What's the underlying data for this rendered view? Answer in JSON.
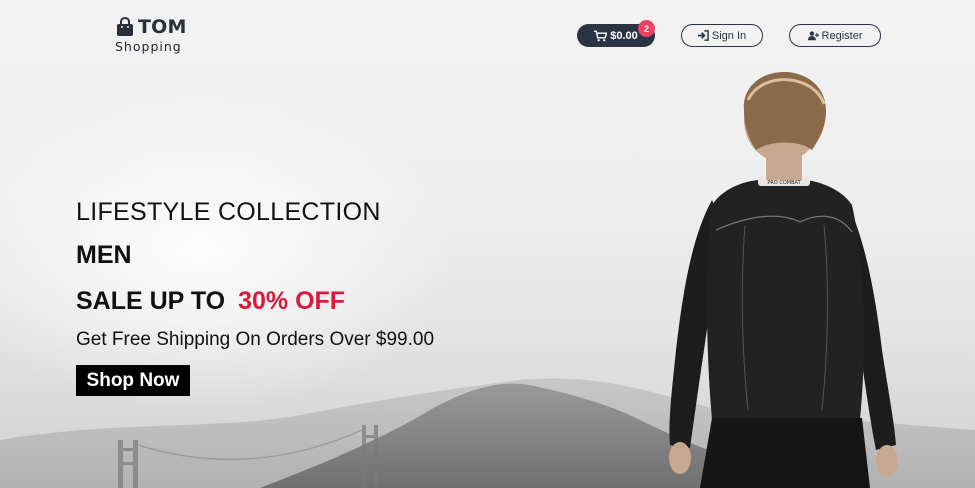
{
  "header": {
    "logo_title": "TOM",
    "logo_subtitle": "Shopping",
    "cart_total": "$0.00",
    "cart_count": "2",
    "signin_label": "Sign In",
    "register_label": "Register"
  },
  "hero": {
    "collection": "LIFESTYLE COLLECTION",
    "category": "MEN",
    "sale_prefix": "SALE UP TO",
    "sale_amount": "30% OFF",
    "shipping": "Get Free Shipping On Orders Over $99.00",
    "cta_label": "Shop Now",
    "shirt_brand": "PRO COMBAT"
  },
  "colors": {
    "dark": "#2b3445",
    "accent": "#d81b3c",
    "badge": "#e94560"
  },
  "icons": [
    "shopping-bag-icon",
    "cart-icon",
    "sign-in-icon",
    "user-plus-icon"
  ]
}
